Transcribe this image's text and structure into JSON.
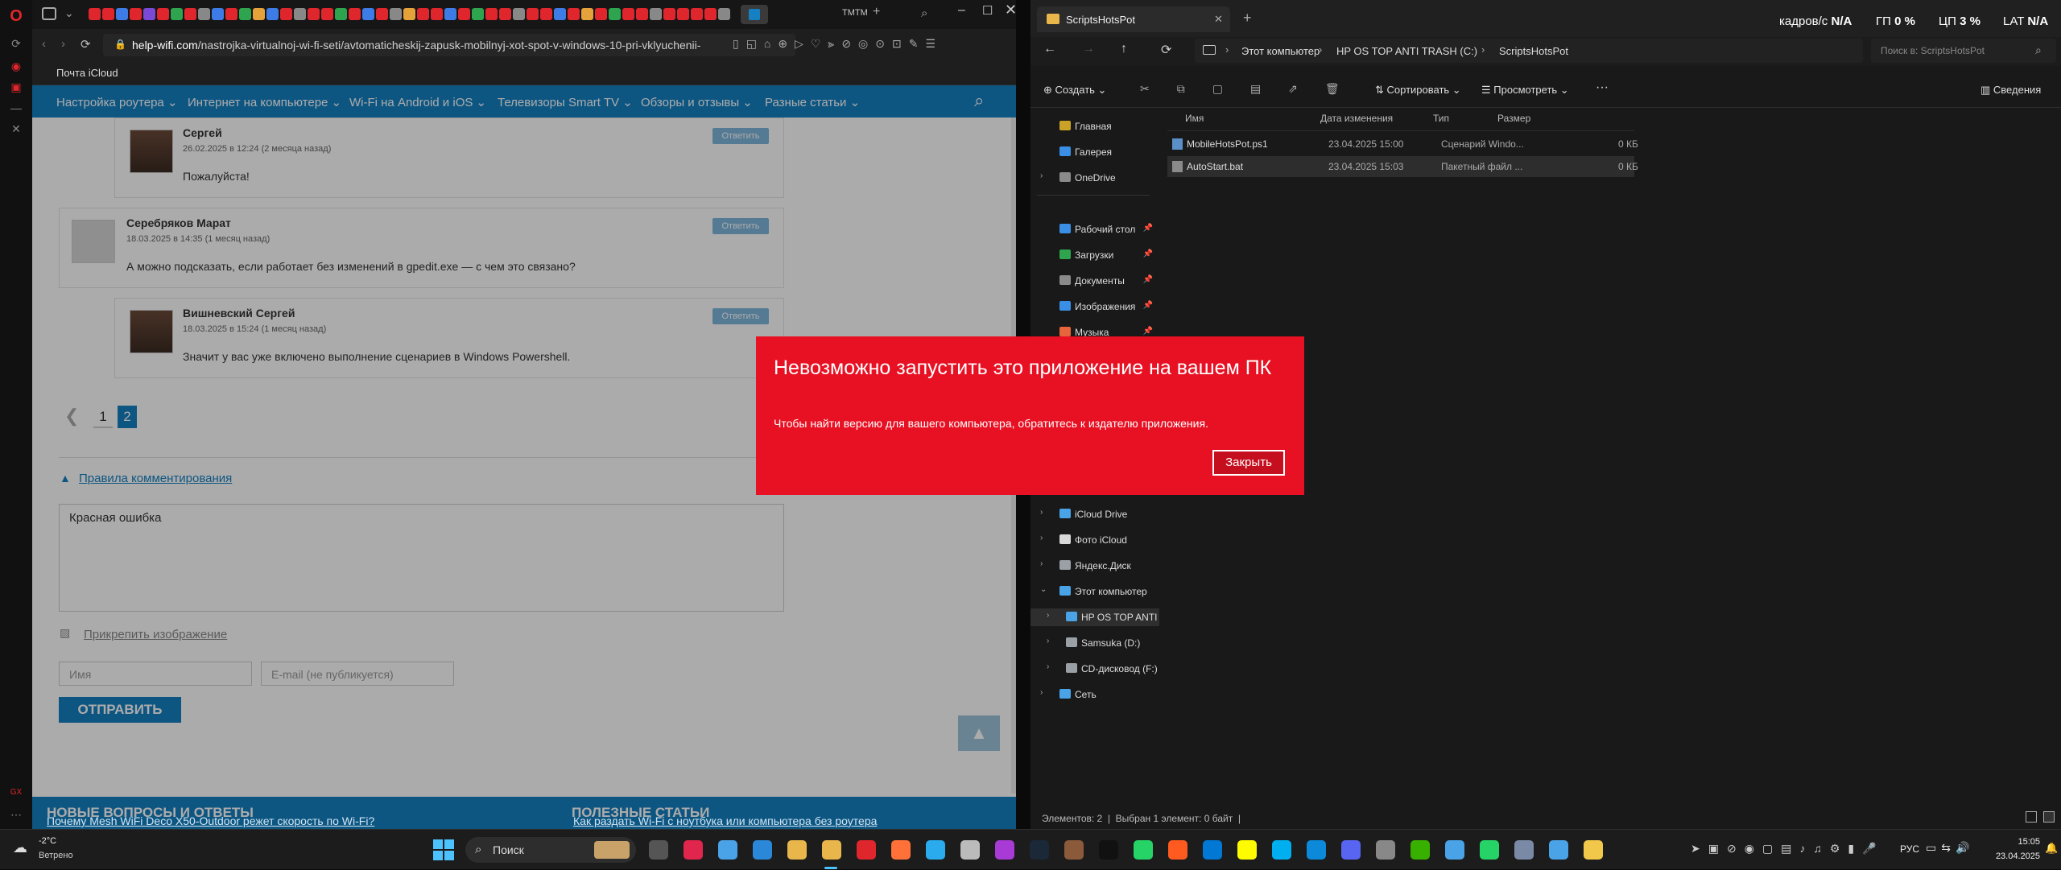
{
  "browser": {
    "url_prefix": "help-wifi.com",
    "url_rest": "/nastrojka-virtualnoj-wi-fi-seti/avtomaticheskij-zapusk-mobilnyj-xot-spot-v-windows-10-pri-vklyuchenii-",
    "tab_label": "ТМТМ",
    "bookmark": "Почта iCloud"
  },
  "site": {
    "nav": [
      "Настройка роутера",
      "Интернет на компьютере",
      "Wi-Fi на Android и iOS",
      "Телевизоры Smart TV",
      "Обзоры и отзывы",
      "Разные статьи"
    ],
    "comments": [
      {
        "name": "Сергей",
        "date": "26.02.2025 в 12:24 (2 месяца назад)",
        "text": "Пожалуйста!",
        "reply": "Ответить"
      },
      {
        "name": "Серебряков Марат",
        "date": "18.03.2025 в 14:35 (1 месяц назад)",
        "text": "А можно подсказать, если работает без изменений в gpedit.exe — с чем это связано?",
        "reply": "Ответить"
      },
      {
        "name": "Вишневский Сергей",
        "date": "18.03.2025 в 15:24 (1 месяц назад)",
        "text": "Значит у вас уже включено выполнение сценариев в Windows Powershell.",
        "reply": "Ответить"
      }
    ],
    "pages": [
      "1",
      "2"
    ],
    "rules_link": "Правила комментирования",
    "comment_text": "Красная ошибка",
    "attach_label": "Прикрепить изображение",
    "name_placeholder": "Имя",
    "email_placeholder": "E-mail (не публикуется)",
    "submit_label": "ОТПРАВИТЬ",
    "footer_left_title": "НОВЫЕ ВОПРОСЫ И ОТВЕТЫ",
    "footer_right_title": "ПОЛЕЗНЫЕ СТАТЬИ",
    "footer_left_link": "Почему Mesh WiFi Deco X50-Outdoor режет скорость по Wi-Fi?",
    "footer_right_link": "Как раздать Wi-Fi с ноутбука или компьютера без роутера"
  },
  "explorer": {
    "tab_title": "ScriptsHotsPot",
    "breadcrumb": [
      "Этот компьютер",
      "HP OS TOP ANTI TRASH (C:)",
      "ScriptsHotsPot"
    ],
    "search_placeholder": "Поиск в: ScriptsHotsPot",
    "toolbar": {
      "create": "Создать",
      "sort": "Сортировать",
      "view": "Просмотреть",
      "more": "···",
      "details": "Сведения"
    },
    "nav": [
      {
        "label": "Главная",
        "color": "#c9a227",
        "pin": false
      },
      {
        "label": "Галерея",
        "color": "#3a8ee6",
        "pin": false
      },
      {
        "label": "OneDrive",
        "color": "#8a8a8a",
        "pin": false
      },
      {
        "label": "Рабочий стол",
        "color": "#3a8ee6",
        "pin": true
      },
      {
        "label": "Загрузки",
        "color": "#2ea44f",
        "pin": true
      },
      {
        "label": "Документы",
        "color": "#8a8a8a",
        "pin": true
      },
      {
        "label": "Изображения",
        "color": "#3a8ee6",
        "pin": true
      },
      {
        "label": "Музыка",
        "color": "#e6653a",
        "pin": true
      },
      {
        "label": "iCloud Drive",
        "color": "#4aa3e6"
      },
      {
        "label": "Фото iCloud",
        "color": "#d8d8d8"
      },
      {
        "label": "Яндекс.Диск",
        "color": "#9aa0a6"
      },
      {
        "label": "Этот компьютер",
        "color": "#4aa3e6"
      },
      {
        "label": "HP OS TOP ANTI",
        "color": "#4aa3e6"
      },
      {
        "label": "Samsuka (D:)",
        "color": "#9aa0a6"
      },
      {
        "label": "CD-дисковод (F:)",
        "color": "#9aa0a6"
      },
      {
        "label": "Сеть",
        "color": "#4aa3e6"
      }
    ],
    "columns": [
      "Имя",
      "Дата изменения",
      "Тип",
      "Размер"
    ],
    "files": [
      {
        "name": "MobileHotsPot.ps1",
        "date": "23.04.2025 15:00",
        "type": "Сценарий Windo...",
        "size": "0 КБ"
      },
      {
        "name": "AutoStart.bat",
        "date": "23.04.2025 15:03",
        "type": "Пакетный файл ...",
        "size": "0 КБ"
      }
    ],
    "status": "Элементов: 2  |  Выбран 1 элемент: 0 байт  |"
  },
  "dialog": {
    "title": "Невозможно запустить это приложение на вашем ПК",
    "message": "Чтобы найти версию для вашего компьютера, обратитесь к издателю приложения.",
    "close_label": "Закрыть"
  },
  "osd": {
    "fps_label": "кадров/с",
    "fps": "N/A",
    "gpu_label": "ГП",
    "gpu": "0 %",
    "cpu_label": "ЦП",
    "cpu": "3 %",
    "lat_label": "LAT",
    "lat": "N/A"
  },
  "taskbar": {
    "weather_temp": "-2°C",
    "weather_text": "Ветрено",
    "search_label": "Поиск",
    "lang": "РУС",
    "time": "15:05",
    "date": "23.04.2025"
  }
}
